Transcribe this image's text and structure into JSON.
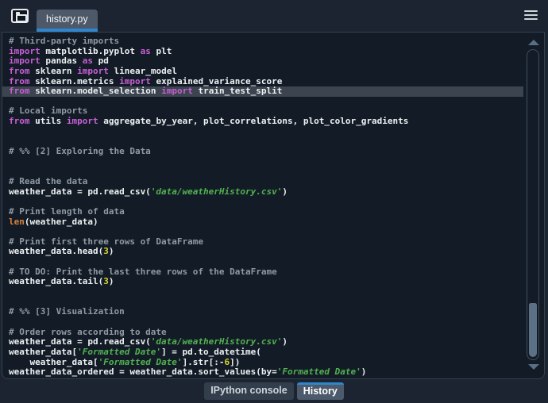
{
  "header": {
    "file_tab_label": "history.py",
    "icons": {
      "left_chip": "file-switcher-icon",
      "right_menu": "hamburger-menu-icon"
    }
  },
  "editor": {
    "language": "python",
    "highlighted_line_text": "from sklearn.model_selection import train_test_split",
    "lines": [
      {
        "h": false,
        "t": [
          [
            "com",
            "# Third-party imports"
          ]
        ]
      },
      {
        "h": false,
        "t": [
          [
            "kw",
            "import"
          ],
          [
            "txt",
            " matplotlib.pyplot "
          ],
          [
            "kw",
            "as"
          ],
          [
            "txt",
            " plt"
          ]
        ]
      },
      {
        "h": false,
        "t": [
          [
            "kw",
            "import"
          ],
          [
            "txt",
            " pandas "
          ],
          [
            "kw",
            "as"
          ],
          [
            "txt",
            " pd"
          ]
        ]
      },
      {
        "h": false,
        "t": [
          [
            "kw",
            "from"
          ],
          [
            "txt",
            " sklearn "
          ],
          [
            "kw",
            "import"
          ],
          [
            "txt",
            " linear_model"
          ]
        ]
      },
      {
        "h": false,
        "t": [
          [
            "kw",
            "from"
          ],
          [
            "txt",
            " sklearn.metrics "
          ],
          [
            "kw",
            "import"
          ],
          [
            "txt",
            " explained_variance_score"
          ]
        ]
      },
      {
        "h": true,
        "t": [
          [
            "kw",
            "from"
          ],
          [
            "txt",
            " sklearn.model_selection "
          ],
          [
            "kw",
            "import"
          ],
          [
            "txt",
            " train_test_split"
          ]
        ]
      },
      {
        "h": false,
        "t": []
      },
      {
        "h": false,
        "t": [
          [
            "com",
            "# Local imports"
          ]
        ]
      },
      {
        "h": false,
        "t": [
          [
            "kw",
            "from"
          ],
          [
            "txt",
            " utils "
          ],
          [
            "kw",
            "import"
          ],
          [
            "txt",
            " aggregate_by_year, plot_correlations, plot_color_gradients"
          ]
        ]
      },
      {
        "h": false,
        "t": []
      },
      {
        "h": false,
        "t": []
      },
      {
        "h": false,
        "t": [
          [
            "com",
            "# %% [2] Exploring the Data"
          ]
        ]
      },
      {
        "h": false,
        "t": []
      },
      {
        "h": false,
        "t": []
      },
      {
        "h": false,
        "t": [
          [
            "com",
            "# Read the data"
          ]
        ]
      },
      {
        "h": false,
        "t": [
          [
            "txt",
            "weather_data = pd.read_csv("
          ],
          [
            "str",
            "'data/weatherHistory.csv'"
          ],
          [
            "txt",
            ")"
          ]
        ]
      },
      {
        "h": false,
        "t": []
      },
      {
        "h": false,
        "t": [
          [
            "com",
            "# Print length of data"
          ]
        ]
      },
      {
        "h": false,
        "t": [
          [
            "bi",
            "len"
          ],
          [
            "txt",
            "(weather_data)"
          ]
        ]
      },
      {
        "h": false,
        "t": []
      },
      {
        "h": false,
        "t": [
          [
            "com",
            "# Print first three rows of DataFrame"
          ]
        ]
      },
      {
        "h": false,
        "t": [
          [
            "txt",
            "weather_data.head("
          ],
          [
            "num",
            "3"
          ],
          [
            "txt",
            ")"
          ]
        ]
      },
      {
        "h": false,
        "t": []
      },
      {
        "h": false,
        "t": [
          [
            "com",
            "# TO DO: Print the last three rows of the DataFrame"
          ]
        ]
      },
      {
        "h": false,
        "t": [
          [
            "txt",
            "weather_data.tail("
          ],
          [
            "num",
            "3"
          ],
          [
            "txt",
            ")"
          ]
        ]
      },
      {
        "h": false,
        "t": []
      },
      {
        "h": false,
        "t": []
      },
      {
        "h": false,
        "t": [
          [
            "com",
            "# %% [3] Visualization"
          ]
        ]
      },
      {
        "h": false,
        "t": []
      },
      {
        "h": false,
        "t": [
          [
            "com",
            "# Order rows according to date"
          ]
        ]
      },
      {
        "h": false,
        "t": [
          [
            "txt",
            "weather_data = pd.read_csv("
          ],
          [
            "str",
            "'data/weatherHistory.csv'"
          ],
          [
            "txt",
            ")"
          ]
        ]
      },
      {
        "h": false,
        "t": [
          [
            "txt",
            "weather_data["
          ],
          [
            "str",
            "'Formatted Date'"
          ],
          [
            "txt",
            "] = pd.to_datetime("
          ]
        ]
      },
      {
        "h": false,
        "t": [
          [
            "txt",
            "    weather_data["
          ],
          [
            "str",
            "'Formatted Date'"
          ],
          [
            "txt",
            "].str[:-"
          ],
          [
            "num",
            "6"
          ],
          [
            "txt",
            "])"
          ]
        ]
      },
      {
        "h": false,
        "t": [
          [
            "txt",
            "weather_data_ordered = weather_data.sort_values(by="
          ],
          [
            "str",
            "'Formatted Date'"
          ],
          [
            "txt",
            ")"
          ]
        ]
      }
    ]
  },
  "footer": {
    "tabs": [
      {
        "label": "IPython console",
        "active": false
      },
      {
        "label": "History",
        "active": true
      }
    ]
  },
  "colors": {
    "chrome_bg": "#1b2430",
    "editor_bg": "#131c26",
    "line_highlight": "#3b444f",
    "accent_blue": "#2f86cd",
    "keyword": "#c75fd4",
    "string": "#52b151",
    "comment": "#8f9aa4",
    "number": "#d6d42e",
    "builtin": "#d9813d",
    "code_text": "#eef1f3",
    "scrollbar": "#5d7186"
  }
}
